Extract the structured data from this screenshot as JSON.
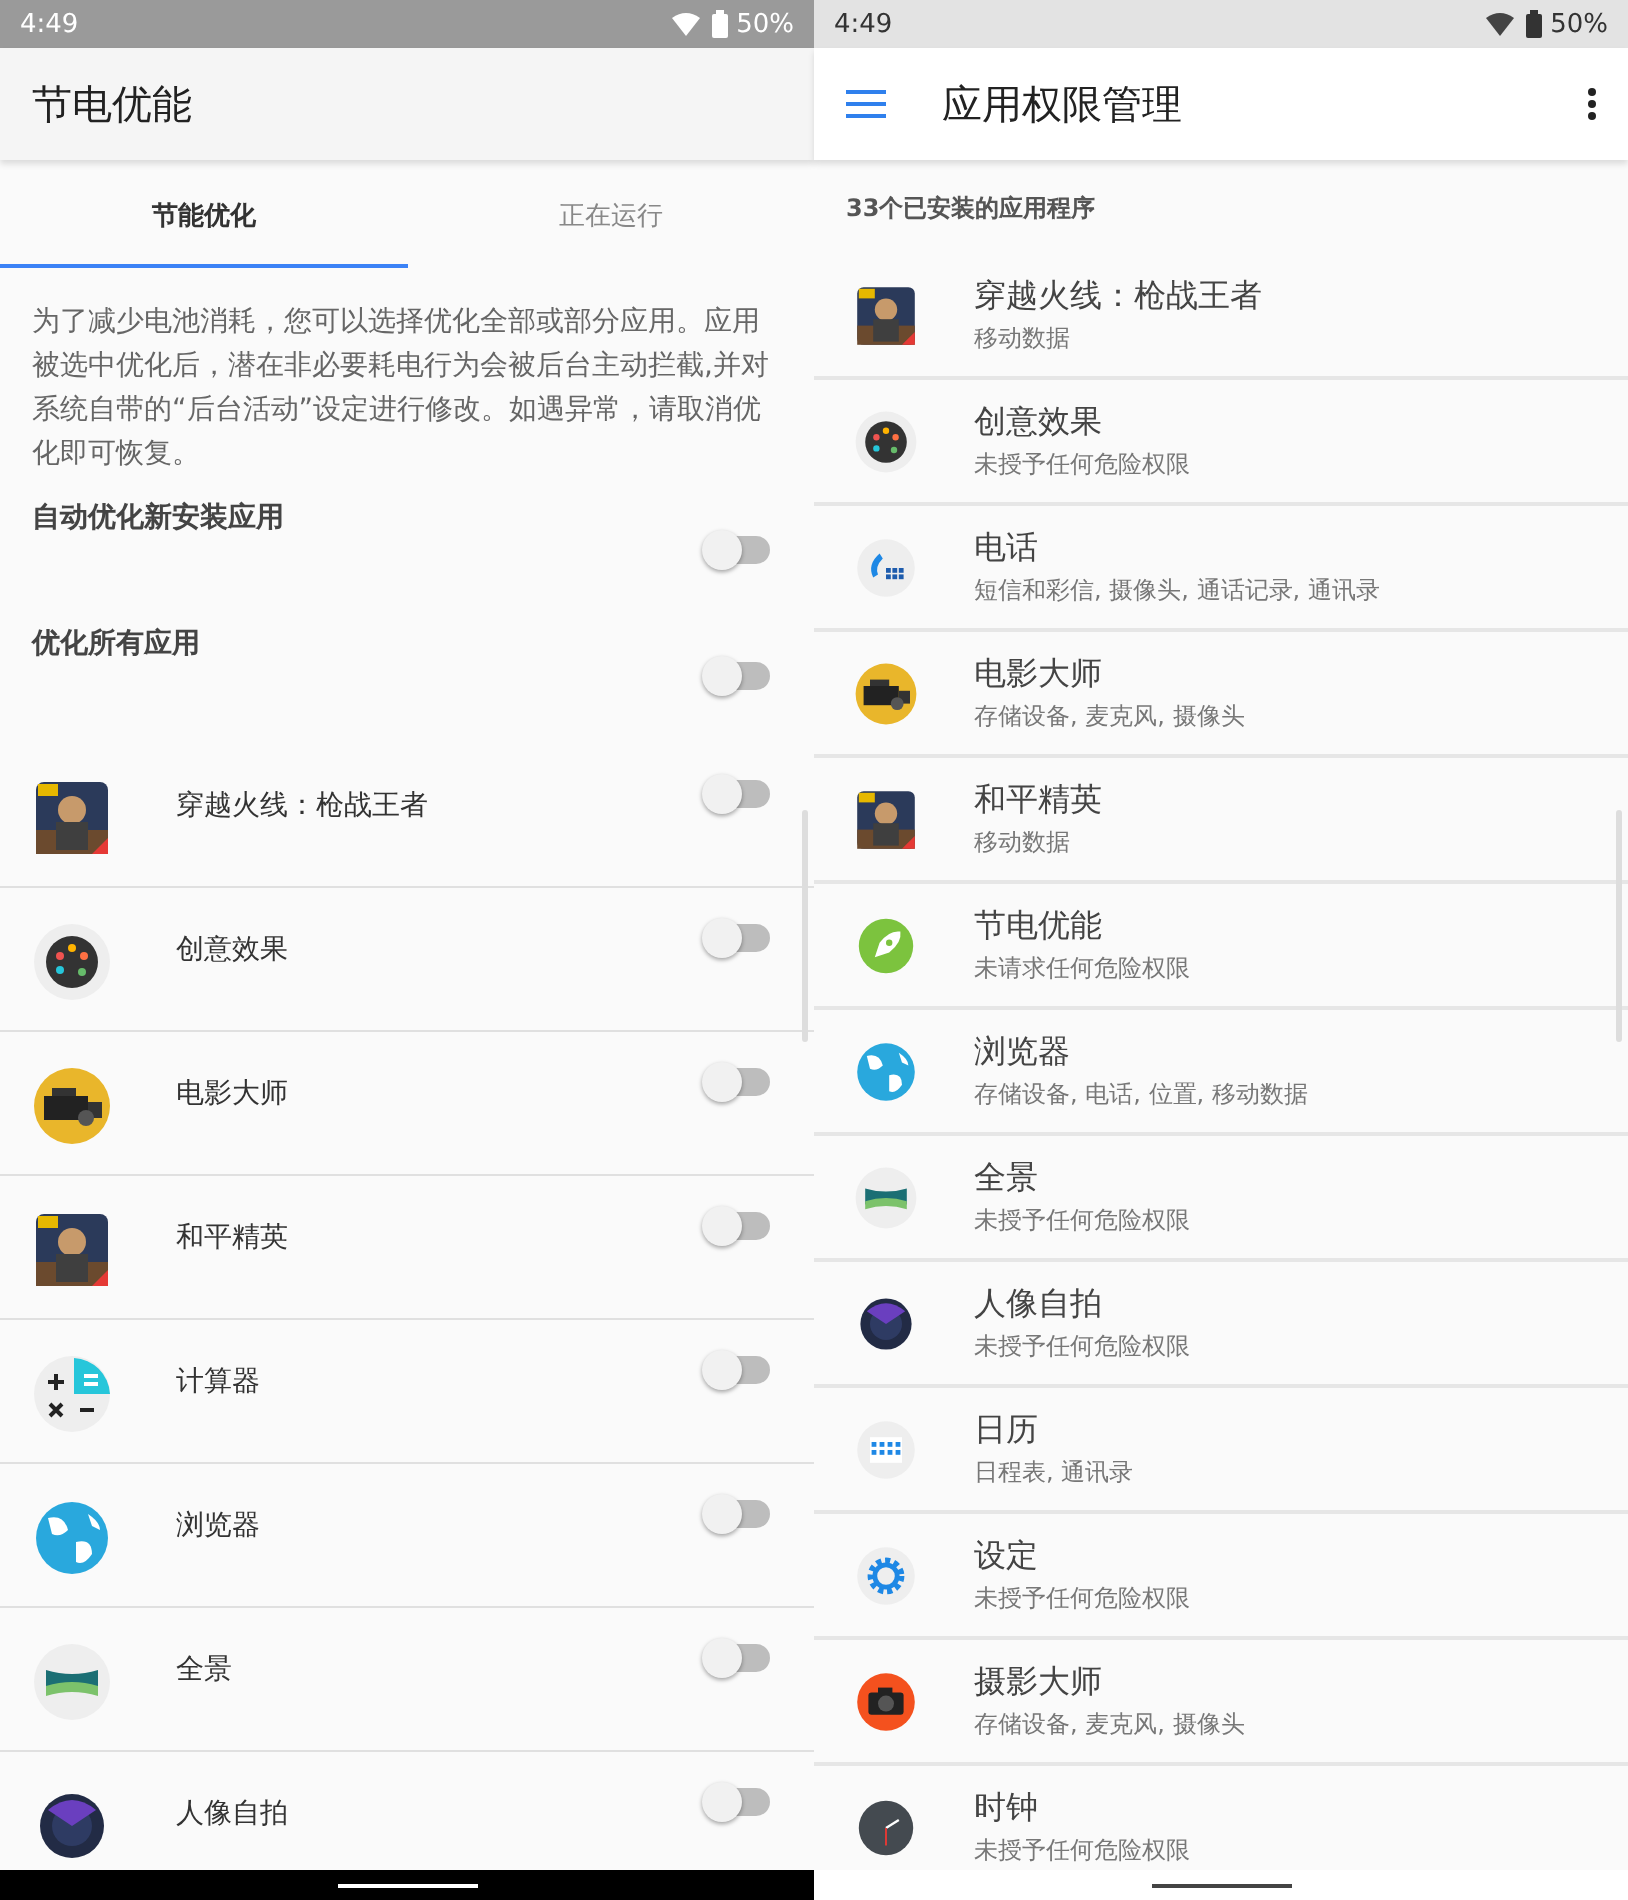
{
  "left_screen": {
    "status_bar": {
      "time": "4:49",
      "battery": "50%"
    },
    "title": "节电优能",
    "tabs": [
      {
        "label": "节能优化",
        "selected": true
      },
      {
        "label": "正在运行",
        "selected": false
      }
    ],
    "description": "为了减少电池消耗，您可以选择优化全部或部分应用。应用被选中优化后，潜在非必要耗电行为会被后台主动拦截,并对系统自带的“后台活动”设定进行修改。如遇异常，请取消优化即可恢复。",
    "settings": [
      {
        "label": "自动优化新安装应用",
        "on": false
      },
      {
        "label": "优化所有应用",
        "on": false
      }
    ],
    "apps": [
      {
        "name": "穿越火线：枪战王者",
        "kind": "picture",
        "on": false
      },
      {
        "name": "创意效果",
        "kind": "palette",
        "on": false
      },
      {
        "name": "电影大师",
        "kind": "movie",
        "on": false
      },
      {
        "name": "和平精英",
        "kind": "picture",
        "on": false
      },
      {
        "name": "计算器",
        "kind": "calculator",
        "on": false
      },
      {
        "name": "浏览器",
        "kind": "globe",
        "on": false
      },
      {
        "name": "全景",
        "kind": "panorama",
        "on": false
      },
      {
        "name": "人像自拍",
        "kind": "lens",
        "on": false
      }
    ]
  },
  "right_screen": {
    "status_bar": {
      "time": "4:49",
      "battery": "50%"
    },
    "title": "应用权限管理",
    "subheader": "33个已安装的应用程序",
    "apps": [
      {
        "name": "穿越火线：枪战王者",
        "permissions": "移动数据",
        "kind": "picture"
      },
      {
        "name": "创意效果",
        "permissions": "未授予任何危险权限",
        "kind": "palette"
      },
      {
        "name": "电话",
        "permissions": "短信和彩信, 摄像头, 通话记录, 通讯录",
        "kind": "phone"
      },
      {
        "name": "电影大师",
        "permissions": "存储设备, 麦克风, 摄像头",
        "kind": "movie"
      },
      {
        "name": "和平精英",
        "permissions": "移动数据",
        "kind": "picture"
      },
      {
        "name": "节电优能",
        "permissions": "未请求任何危险权限",
        "kind": "rocket"
      },
      {
        "name": "浏览器",
        "permissions": "存储设备, 电话, 位置, 移动数据",
        "kind": "globe"
      },
      {
        "name": "全景",
        "permissions": "未授予任何危险权限",
        "kind": "panorama"
      },
      {
        "name": "人像自拍",
        "permissions": "未授予任何危险权限",
        "kind": "lens"
      },
      {
        "name": "日历",
        "permissions": "日程表, 通讯录",
        "kind": "calendar"
      },
      {
        "name": "设定",
        "permissions": "未授予任何危险权限",
        "kind": "gear"
      },
      {
        "name": "摄影大师",
        "permissions": "存储设备, 麦克风, 摄像头",
        "kind": "camera"
      },
      {
        "name": "时钟",
        "permissions": "未授予任何危险权限",
        "kind": "clock"
      }
    ]
  }
}
